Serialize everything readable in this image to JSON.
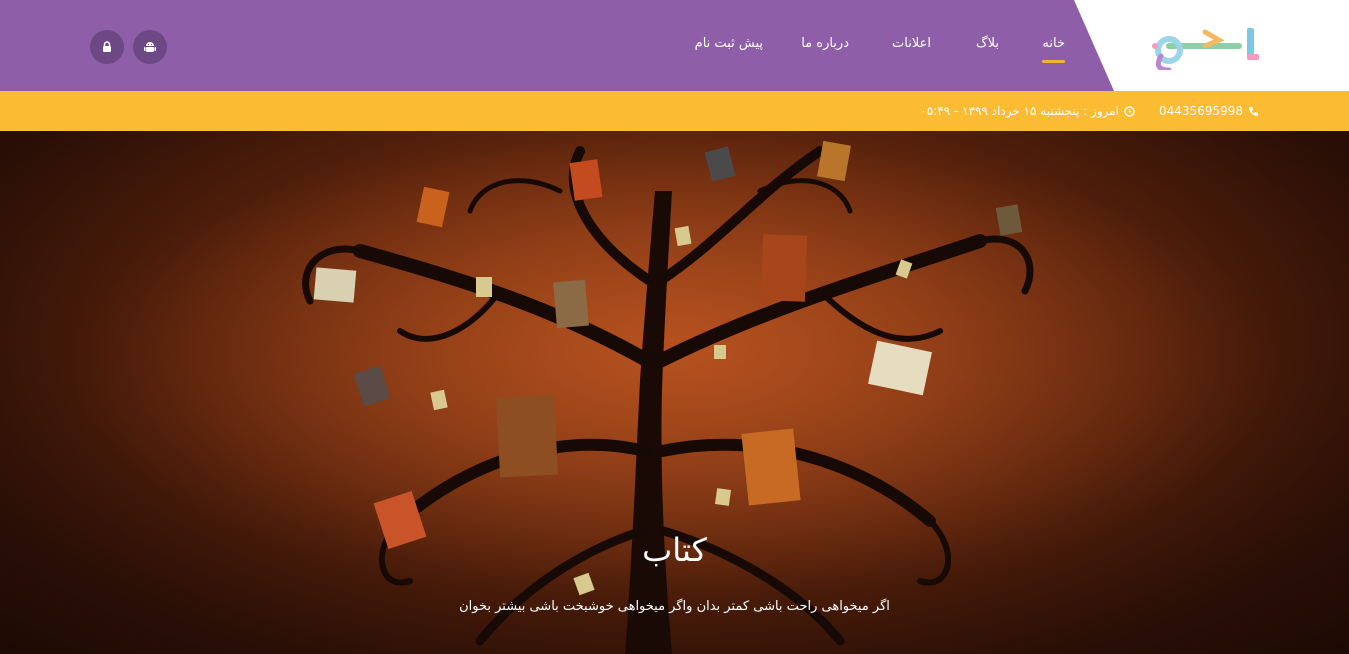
{
  "logo": {
    "icon": "site-logo"
  },
  "nav": {
    "items": [
      {
        "label": "خانه",
        "active": true
      },
      {
        "label": "بلاگ",
        "active": false
      },
      {
        "label": "اعلانات",
        "active": false
      },
      {
        "label": "درباره ما",
        "active": false
      },
      {
        "label": "پیش ثبت نام",
        "active": false
      }
    ]
  },
  "header_buttons": [
    {
      "icon": "android-icon"
    },
    {
      "icon": "lock-icon"
    }
  ],
  "info": {
    "phone": "04435695998",
    "date": "امروز : پنجشنبه ۱۵ خرداد ۱۳۹۹ - ۰۵:۴۹"
  },
  "hero": {
    "title": "کتاب",
    "subtitle": "اگر میخواهی راحت باشی کمتر بدان واگر میخواهی خوشبخت باشی بیشتر بخوان"
  },
  "colors": {
    "header": "#8e5fa8",
    "info_bar": "#fbbc34",
    "active_underline": "#f5b335",
    "button": "#6e4785"
  }
}
